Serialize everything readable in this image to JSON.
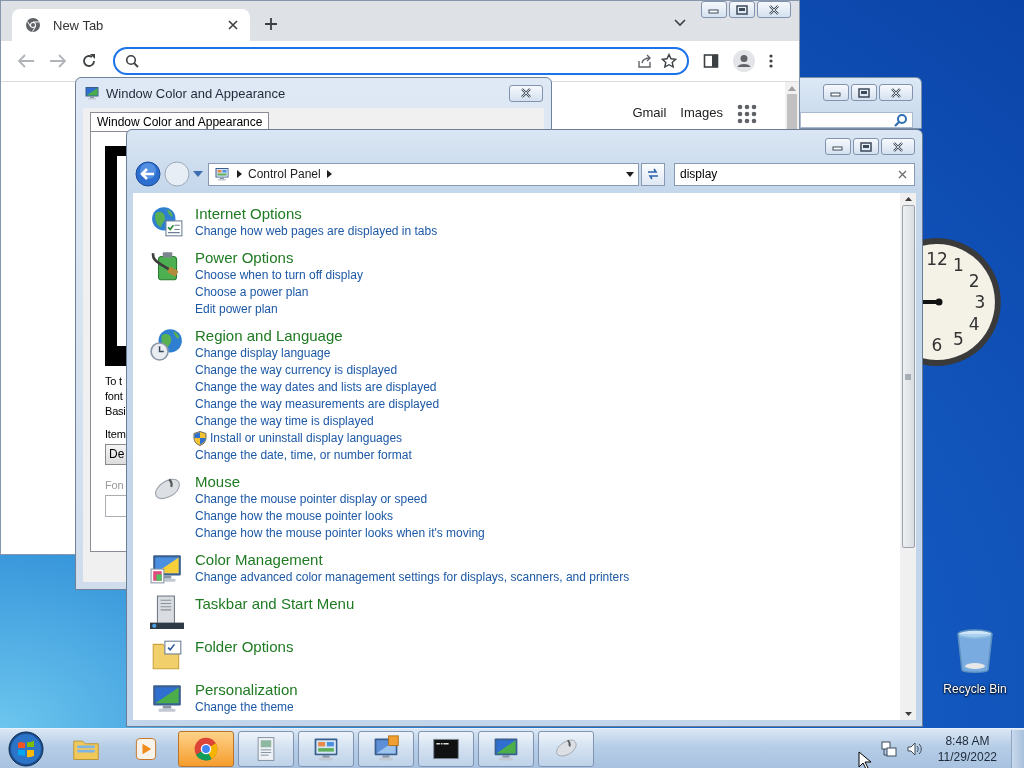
{
  "browser": {
    "tab": {
      "title": "New Tab"
    },
    "links": [
      "Gmail",
      "Images"
    ]
  },
  "dialog": {
    "title": "Window Color and Appearance",
    "tab": "Window Color and Appearance",
    "description_lines": [
      "To t",
      "font",
      "Basi"
    ],
    "item_label": "Item",
    "item_value": "De",
    "font_label": "Fon"
  },
  "control_panel": {
    "address": [
      "Control Panel"
    ],
    "search": {
      "value": "display"
    },
    "results": [
      {
        "kind": "internet",
        "title": "Internet Options",
        "links": [
          {
            "text": "Change how web pages are displayed in tabs",
            "shield": false
          }
        ]
      },
      {
        "kind": "power",
        "title": "Power Options",
        "links": [
          {
            "text": "Choose when to turn off display",
            "shield": false
          },
          {
            "text": "Choose a power plan",
            "shield": false
          },
          {
            "text": "Edit power plan",
            "shield": false
          }
        ]
      },
      {
        "kind": "region",
        "title": "Region and Language",
        "links": [
          {
            "text": "Change display language",
            "shield": false
          },
          {
            "text": "Change the way currency is displayed",
            "shield": false
          },
          {
            "text": "Change the way dates and lists are displayed",
            "shield": false
          },
          {
            "text": "Change the way measurements are displayed",
            "shield": false
          },
          {
            "text": "Change the way time is displayed",
            "shield": false
          },
          {
            "text": "Install or uninstall display languages",
            "shield": true
          },
          {
            "text": "Change the date, time, or number format",
            "shield": false
          }
        ]
      },
      {
        "kind": "mouse",
        "title": "Mouse",
        "links": [
          {
            "text": "Change the mouse pointer display or speed",
            "shield": false
          },
          {
            "text": "Change how the mouse pointer looks",
            "shield": false
          },
          {
            "text": "Change how the mouse pointer looks when it's moving",
            "shield": false
          }
        ]
      },
      {
        "kind": "color",
        "title": "Color Management",
        "links": [
          {
            "text": "Change advanced color management settings for displays, scanners, and printers",
            "shield": false
          }
        ]
      },
      {
        "kind": "taskbar",
        "title": "Taskbar and Start Menu"
      },
      {
        "kind": "folder",
        "title": "Folder Options"
      },
      {
        "kind": "personalization",
        "title": "Personalization",
        "links": [
          {
            "text": "Change the theme",
            "shield": false
          }
        ]
      }
    ]
  },
  "desktop": {
    "clock_numerals": [
      "12",
      "1",
      "2",
      "3",
      "4",
      "5",
      "6"
    ],
    "icons": [
      {
        "label": "Recycle Bin"
      }
    ]
  },
  "taskbar": {
    "buttons": [
      {
        "kind": "explorer",
        "running": false,
        "highlighted": false
      },
      {
        "kind": "media",
        "running": false,
        "highlighted": false
      },
      {
        "kind": "chrome",
        "running": true,
        "highlighted": true
      },
      {
        "kind": "document",
        "running": true,
        "highlighted": false
      },
      {
        "kind": "control-panel",
        "running": true,
        "highlighted": false
      },
      {
        "kind": "display",
        "running": true,
        "highlighted": false
      },
      {
        "kind": "terminal",
        "running": true,
        "highlighted": false
      },
      {
        "kind": "personalization",
        "running": true,
        "highlighted": false
      },
      {
        "kind": "mouse",
        "running": true,
        "highlighted": false
      }
    ],
    "time": "8:48 AM",
    "date": "11/29/2022"
  }
}
